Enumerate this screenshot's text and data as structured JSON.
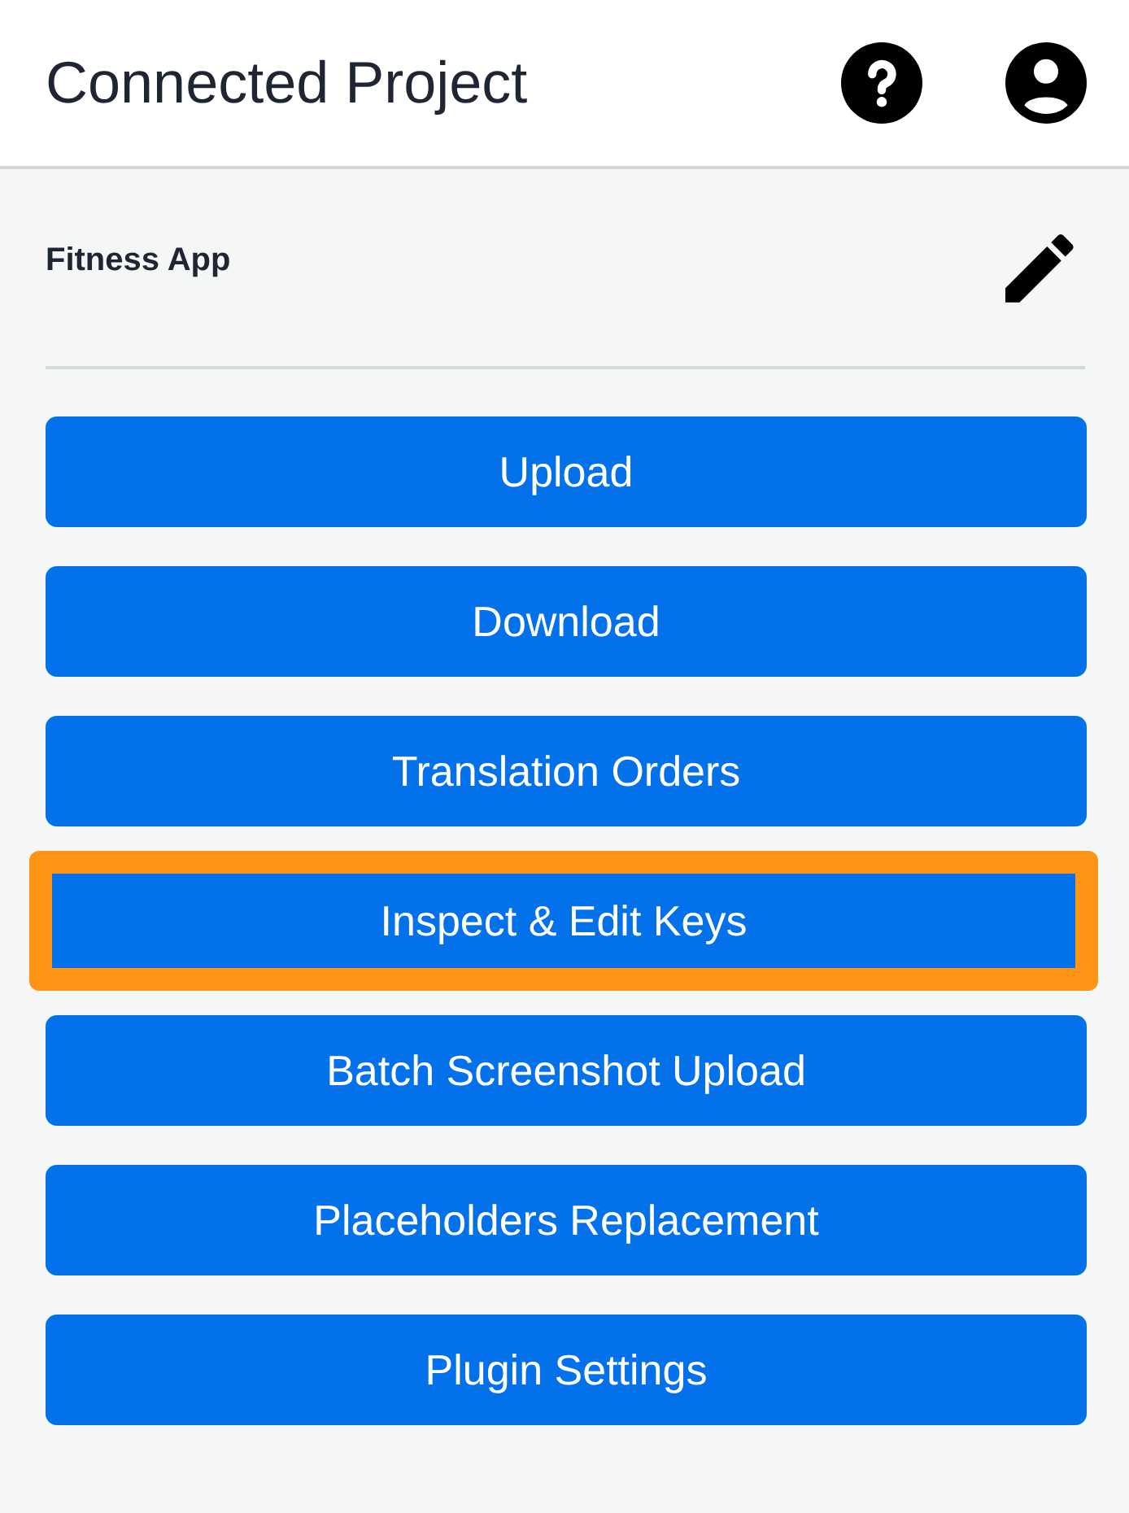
{
  "header": {
    "title": "Connected Project"
  },
  "project": {
    "name": "Fitness App"
  },
  "buttons": [
    {
      "label": "Upload",
      "selected": false
    },
    {
      "label": "Download",
      "selected": false
    },
    {
      "label": "Translation Orders",
      "selected": false
    },
    {
      "label": "Inspect & Edit Keys",
      "selected": true
    },
    {
      "label": "Batch Screenshot Upload",
      "selected": false
    },
    {
      "label": "Placeholders Replacement",
      "selected": false
    },
    {
      "label": "Plugin Settings",
      "selected": false
    }
  ]
}
